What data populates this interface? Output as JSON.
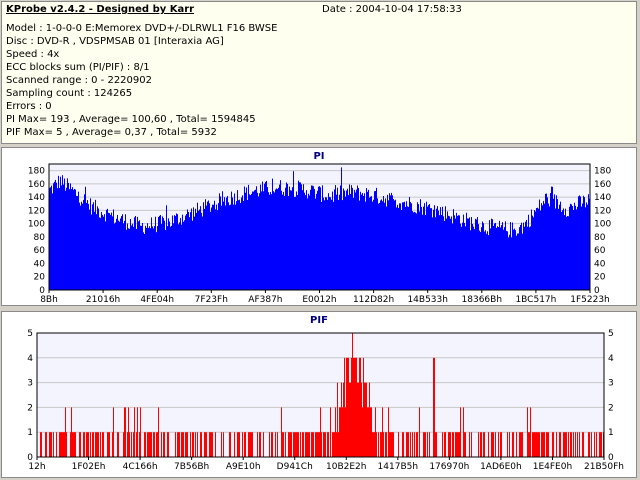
{
  "header": {
    "app_title": "KProbe v2.4.2 - Designed by Karr",
    "date": "Date : 2004-10-04 17:58:33"
  },
  "info_lines": [
    "Model : 1-0-0-0 E:Memorex DVD+/-DLRWL1 F16 BWSE",
    "Disc : DVD-R , VDSPMSAB 01 [Interaxia AG]",
    "Speed : 4x",
    "ECC blocks sum (PI/PIF) : 8/1",
    "Scanned range : 0 - 2220902",
    "Sampling count : 124265",
    "Errors : 0",
    "PI Max= 193 , Average= 100,60 , Total= 1594845",
    "PIF Max= 5 , Average= 0,37 , Total= 5932"
  ],
  "colors": {
    "pi_bar": "#0000ff",
    "pif_bar": "#ff0000",
    "grid": "#c8c8c8",
    "plot_bg": "#f4f4ff"
  },
  "chart_data": [
    {
      "type": "bar",
      "title": "PI",
      "ylim": [
        0,
        190
      ],
      "yticks": [
        0,
        20,
        40,
        60,
        80,
        100,
        120,
        140,
        160,
        180
      ],
      "xtick_labels": [
        "8Bh",
        "21016h",
        "4FE04h",
        "7F23Fh",
        "AF387h",
        "E0012h",
        "112D82h",
        "14B533h",
        "18366Bh",
        "1BC517h",
        "1F5223h"
      ],
      "profile": [
        [
          0,
          150
        ],
        [
          0.02,
          165
        ],
        [
          0.05,
          145
        ],
        [
          0.08,
          125
        ],
        [
          0.12,
          110
        ],
        [
          0.17,
          96
        ],
        [
          0.22,
          102
        ],
        [
          0.27,
          118
        ],
        [
          0.32,
          135
        ],
        [
          0.37,
          148
        ],
        [
          0.42,
          155
        ],
        [
          0.47,
          152
        ],
        [
          0.52,
          142
        ],
        [
          0.56,
          148
        ],
        [
          0.6,
          143
        ],
        [
          0.64,
          135
        ],
        [
          0.68,
          128
        ],
        [
          0.72,
          120
        ],
        [
          0.76,
          108
        ],
        [
          0.8,
          97
        ],
        [
          0.84,
          92
        ],
        [
          0.86,
          90
        ],
        [
          0.88,
          98
        ],
        [
          0.9,
          118
        ],
        [
          0.92,
          138
        ],
        [
          0.94,
          132
        ],
        [
          0.96,
          122
        ],
        [
          0.98,
          130
        ],
        [
          1.0,
          135
        ]
      ],
      "peak_max": 193
    },
    {
      "type": "bar",
      "title": "PIF",
      "ylim": [
        0,
        5
      ],
      "yticks": [
        0,
        1,
        2,
        3,
        4,
        5
      ],
      "xtick_labels": [
        "12h",
        "1F02Eh",
        "4C166h",
        "7B56Bh",
        "A9E10h",
        "D941Ch",
        "10B2E2h",
        "1417B5h",
        "176970h",
        "1AD6E0h",
        "1E4FE0h",
        "21B50Fh"
      ],
      "baseline_level": 1,
      "cluster_region": [
        0.52,
        0.6
      ],
      "peak_max": 5
    }
  ]
}
